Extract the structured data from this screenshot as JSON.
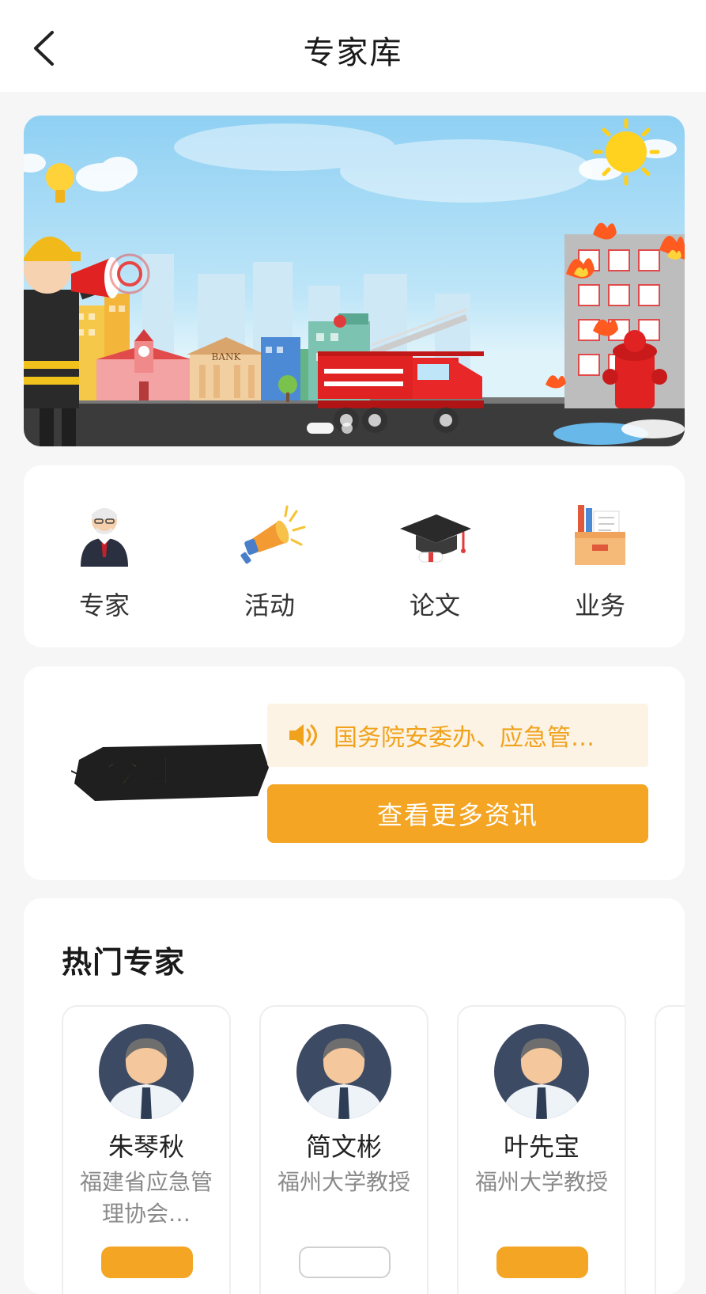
{
  "header": {
    "title": "专家库"
  },
  "categories": [
    {
      "label": "专家",
      "icon": "expert-icon"
    },
    {
      "label": "活动",
      "icon": "megaphone-icon"
    },
    {
      "label": "论文",
      "icon": "graduation-cap-icon"
    },
    {
      "label": "业务",
      "icon": "file-box-icon"
    }
  ],
  "recommend": {
    "badge": "今日推荐",
    "notice": "国务院安委办、应急管…",
    "more_button": "查看更多资讯"
  },
  "hot_experts": {
    "title": "热门专家",
    "experts": [
      {
        "name": "朱琴秋",
        "desc": "福建省应急管理协会…"
      },
      {
        "name": "简文彬",
        "desc": "福州大学教授"
      },
      {
        "name": "叶先宝",
        "desc": "福州大学教授"
      }
    ]
  },
  "banner": {
    "sign_text": "BANK"
  },
  "colors": {
    "accent": "#f3a523",
    "notice_bg": "#fdf3e4",
    "notice_text": "#f0a21c"
  }
}
